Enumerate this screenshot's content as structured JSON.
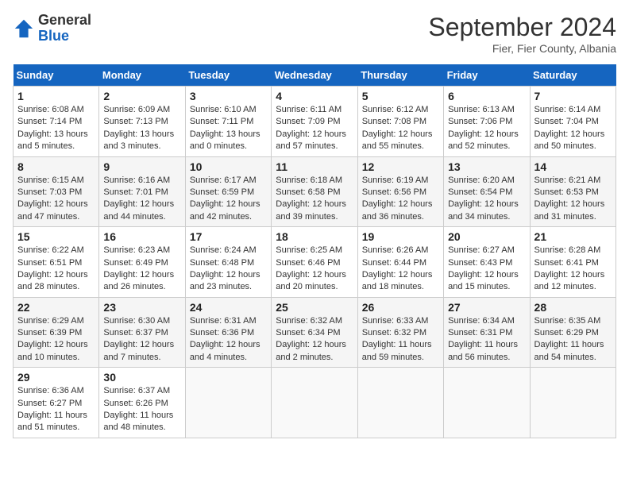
{
  "header": {
    "logo_line1": "General",
    "logo_line2": "Blue",
    "month": "September 2024",
    "location": "Fier, Fier County, Albania"
  },
  "weekdays": [
    "Sunday",
    "Monday",
    "Tuesday",
    "Wednesday",
    "Thursday",
    "Friday",
    "Saturday"
  ],
  "weeks": [
    [
      {
        "day": "1",
        "info": "Sunrise: 6:08 AM\nSunset: 7:14 PM\nDaylight: 13 hours and 5 minutes."
      },
      {
        "day": "2",
        "info": "Sunrise: 6:09 AM\nSunset: 7:13 PM\nDaylight: 13 hours and 3 minutes."
      },
      {
        "day": "3",
        "info": "Sunrise: 6:10 AM\nSunset: 7:11 PM\nDaylight: 13 hours and 0 minutes."
      },
      {
        "day": "4",
        "info": "Sunrise: 6:11 AM\nSunset: 7:09 PM\nDaylight: 12 hours and 57 minutes."
      },
      {
        "day": "5",
        "info": "Sunrise: 6:12 AM\nSunset: 7:08 PM\nDaylight: 12 hours and 55 minutes."
      },
      {
        "day": "6",
        "info": "Sunrise: 6:13 AM\nSunset: 7:06 PM\nDaylight: 12 hours and 52 minutes."
      },
      {
        "day": "7",
        "info": "Sunrise: 6:14 AM\nSunset: 7:04 PM\nDaylight: 12 hours and 50 minutes."
      }
    ],
    [
      {
        "day": "8",
        "info": "Sunrise: 6:15 AM\nSunset: 7:03 PM\nDaylight: 12 hours and 47 minutes."
      },
      {
        "day": "9",
        "info": "Sunrise: 6:16 AM\nSunset: 7:01 PM\nDaylight: 12 hours and 44 minutes."
      },
      {
        "day": "10",
        "info": "Sunrise: 6:17 AM\nSunset: 6:59 PM\nDaylight: 12 hours and 42 minutes."
      },
      {
        "day": "11",
        "info": "Sunrise: 6:18 AM\nSunset: 6:58 PM\nDaylight: 12 hours and 39 minutes."
      },
      {
        "day": "12",
        "info": "Sunrise: 6:19 AM\nSunset: 6:56 PM\nDaylight: 12 hours and 36 minutes."
      },
      {
        "day": "13",
        "info": "Sunrise: 6:20 AM\nSunset: 6:54 PM\nDaylight: 12 hours and 34 minutes."
      },
      {
        "day": "14",
        "info": "Sunrise: 6:21 AM\nSunset: 6:53 PM\nDaylight: 12 hours and 31 minutes."
      }
    ],
    [
      {
        "day": "15",
        "info": "Sunrise: 6:22 AM\nSunset: 6:51 PM\nDaylight: 12 hours and 28 minutes."
      },
      {
        "day": "16",
        "info": "Sunrise: 6:23 AM\nSunset: 6:49 PM\nDaylight: 12 hours and 26 minutes."
      },
      {
        "day": "17",
        "info": "Sunrise: 6:24 AM\nSunset: 6:48 PM\nDaylight: 12 hours and 23 minutes."
      },
      {
        "day": "18",
        "info": "Sunrise: 6:25 AM\nSunset: 6:46 PM\nDaylight: 12 hours and 20 minutes."
      },
      {
        "day": "19",
        "info": "Sunrise: 6:26 AM\nSunset: 6:44 PM\nDaylight: 12 hours and 18 minutes."
      },
      {
        "day": "20",
        "info": "Sunrise: 6:27 AM\nSunset: 6:43 PM\nDaylight: 12 hours and 15 minutes."
      },
      {
        "day": "21",
        "info": "Sunrise: 6:28 AM\nSunset: 6:41 PM\nDaylight: 12 hours and 12 minutes."
      }
    ],
    [
      {
        "day": "22",
        "info": "Sunrise: 6:29 AM\nSunset: 6:39 PM\nDaylight: 12 hours and 10 minutes."
      },
      {
        "day": "23",
        "info": "Sunrise: 6:30 AM\nSunset: 6:37 PM\nDaylight: 12 hours and 7 minutes."
      },
      {
        "day": "24",
        "info": "Sunrise: 6:31 AM\nSunset: 6:36 PM\nDaylight: 12 hours and 4 minutes."
      },
      {
        "day": "25",
        "info": "Sunrise: 6:32 AM\nSunset: 6:34 PM\nDaylight: 12 hours and 2 minutes."
      },
      {
        "day": "26",
        "info": "Sunrise: 6:33 AM\nSunset: 6:32 PM\nDaylight: 11 hours and 59 minutes."
      },
      {
        "day": "27",
        "info": "Sunrise: 6:34 AM\nSunset: 6:31 PM\nDaylight: 11 hours and 56 minutes."
      },
      {
        "day": "28",
        "info": "Sunrise: 6:35 AM\nSunset: 6:29 PM\nDaylight: 11 hours and 54 minutes."
      }
    ],
    [
      {
        "day": "29",
        "info": "Sunrise: 6:36 AM\nSunset: 6:27 PM\nDaylight: 11 hours and 51 minutes."
      },
      {
        "day": "30",
        "info": "Sunrise: 6:37 AM\nSunset: 6:26 PM\nDaylight: 11 hours and 48 minutes."
      },
      {
        "day": "",
        "info": ""
      },
      {
        "day": "",
        "info": ""
      },
      {
        "day": "",
        "info": ""
      },
      {
        "day": "",
        "info": ""
      },
      {
        "day": "",
        "info": ""
      }
    ]
  ]
}
